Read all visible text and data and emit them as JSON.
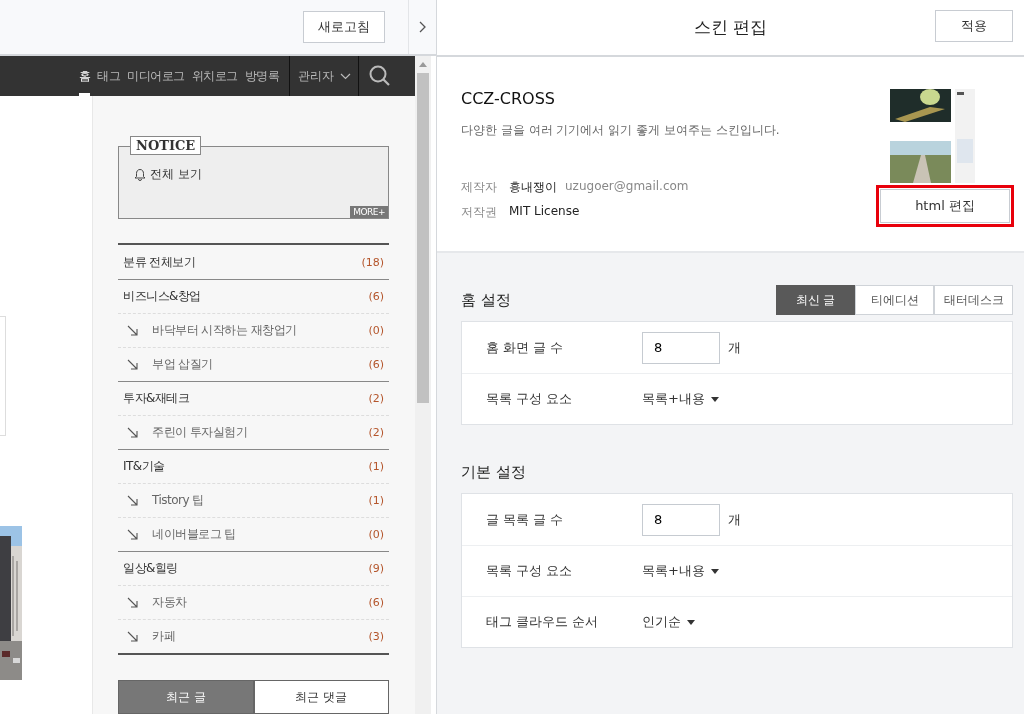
{
  "preview": {
    "refresh_button": "새로고침",
    "nav_items": [
      {
        "label": "홈",
        "selected": true
      },
      {
        "label": "태그",
        "selected": false
      },
      {
        "label": "미디어로그",
        "selected": false
      },
      {
        "label": "위치로그",
        "selected": false
      },
      {
        "label": "방명록",
        "selected": false
      }
    ],
    "admin_menu": "관리자",
    "notice": {
      "title": "NOTICE",
      "link": "전체 보기",
      "more": "MORE+"
    },
    "categories": {
      "all": {
        "name": "분류 전체보기",
        "count": "(18)"
      },
      "groups": [
        {
          "name": "비즈니스&창업",
          "count": "(6)",
          "children": [
            {
              "name": "바닥부터 시작하는 재창업기",
              "count": "(0)"
            },
            {
              "name": "부업 삽질기",
              "count": "(6)"
            }
          ]
        },
        {
          "name": "투자&재테크",
          "count": "(2)",
          "children": [
            {
              "name": "주린이 투자실험기",
              "count": "(2)"
            }
          ]
        },
        {
          "name": "IT&기술",
          "count": "(1)",
          "children": [
            {
              "name": "Tistory 팁",
              "count": "(1)"
            },
            {
              "name": "네이버블로그 팁",
              "count": "(0)"
            }
          ]
        },
        {
          "name": "일상&힐링",
          "count": "(9)",
          "children": [
            {
              "name": "자동차",
              "count": "(6)"
            },
            {
              "name": "카페",
              "count": "(3)"
            }
          ]
        }
      ]
    },
    "recent_tabs": [
      {
        "label": "최근 글",
        "selected": true
      },
      {
        "label": "최근 댓글",
        "selected": false
      }
    ]
  },
  "editor": {
    "title": "스킨 편집",
    "apply_button": "적용",
    "skin": {
      "name": "CCZ-CROSS",
      "description": "다양한 글을 여러 기기에서 읽기 좋게 보여주는 스킨입니다.",
      "author_label": "제작자",
      "author_name": "흉내쟁이",
      "author_email": "uzugoer@gmail.com",
      "license_label": "저작권",
      "license": "MIT License",
      "edit_button": "html 편집",
      "edit_highlighted": true
    },
    "sections": [
      {
        "title": "홈 설정",
        "tabs": [
          {
            "label": "최신 글",
            "selected": true
          },
          {
            "label": "티에디션",
            "selected": false
          },
          {
            "label": "태터데스크",
            "selected": false
          }
        ],
        "rows": [
          {
            "label": "홈 화면 글 수",
            "kind": "number",
            "value": "8",
            "unit": "개"
          },
          {
            "label": "목록 구성 요소",
            "kind": "select",
            "value": "목록+내용"
          }
        ]
      },
      {
        "title": "기본 설정",
        "rows": [
          {
            "label": "글 목록 글 수",
            "kind": "number",
            "value": "8",
            "unit": "개"
          },
          {
            "label": "목록 구성 요소",
            "kind": "select",
            "value": "목록+내용"
          },
          {
            "label": "태그 클라우드 순서",
            "kind": "select",
            "value": "인기순"
          }
        ]
      }
    ]
  }
}
